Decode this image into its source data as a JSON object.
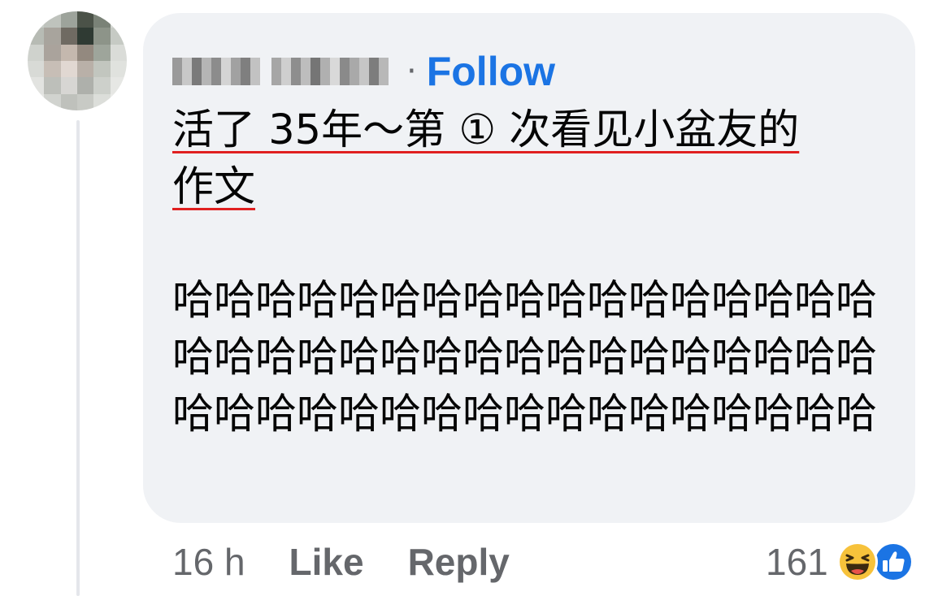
{
  "comment": {
    "author_name": "",
    "follow_label": "Follow",
    "separator": "·",
    "line1": "活了 35年～第 ① 次看见小盆友的",
    "line2": "作文",
    "body": "哈哈哈哈哈哈哈哈哈哈哈哈哈哈哈哈哈哈哈哈哈哈哈哈哈哈哈哈哈哈哈哈哈哈哈哈哈哈哈哈哈哈哈哈哈哈哈哈哈哈哈"
  },
  "actions": {
    "time": "16 h",
    "like_label": "Like",
    "reply_label": "Reply"
  },
  "reactions": {
    "count": "161",
    "icons": [
      "haha-icon",
      "like-icon"
    ]
  },
  "colors": {
    "bubble": "#f0f2f5",
    "follow": "#1b74e4",
    "meta_text": "#65676b",
    "underline": "#e02020",
    "like_blue": "#1b74e4",
    "haha_yellow": "#f7c23b"
  }
}
